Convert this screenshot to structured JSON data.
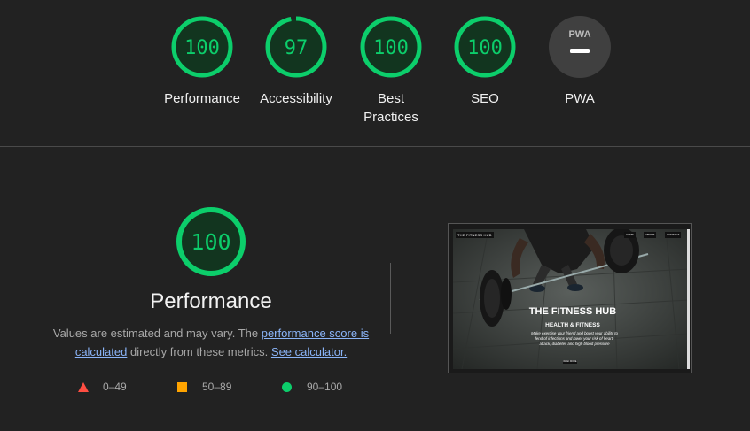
{
  "colors": {
    "pass": "#0cce6b",
    "average": "#ffa400",
    "fail": "#ff4e42",
    "pwa_bg": "#404040",
    "background": "#222222"
  },
  "categories": [
    {
      "label": "Performance",
      "score": "100",
      "fraction": 1.0
    },
    {
      "label": "Accessibility",
      "score": "97",
      "fraction": 0.97
    },
    {
      "label": "Best\nPractices",
      "score": "100",
      "fraction": 1.0
    },
    {
      "label": "SEO",
      "score": "100",
      "fraction": 1.0
    },
    {
      "label": "PWA",
      "badge": "PWA",
      "icon": "pwa-dash-icon"
    }
  ],
  "performance": {
    "score": "100",
    "title": "Performance",
    "desc_prefix": "Values are estimated and may vary. The ",
    "link_score": "performance score is calculated",
    "desc_middle": " directly from these metrics. ",
    "link_calculator": "See calculator."
  },
  "legend": [
    {
      "icon": "triangle-icon",
      "range": "0–49"
    },
    {
      "icon": "square-icon",
      "range": "50–89"
    },
    {
      "icon": "circle-icon",
      "range": "90–100"
    }
  ],
  "thumbnail": {
    "brand": "THE FITNESS HUB",
    "nav": [
      "HOME",
      "ABOUT",
      "CONTACT"
    ],
    "hero_title": "THE FITNESS HUB",
    "hero_subtitle": "HEALTH & FITNESS",
    "hero_body": "Make exercise your friend and boost your ability to fend of infections and lower your risk of heart-attack, diabetes and high blood pressure",
    "button": "READ MORE"
  }
}
